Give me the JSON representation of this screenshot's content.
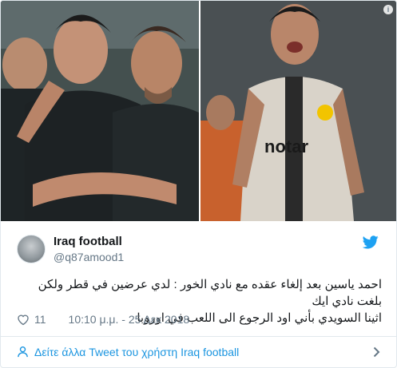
{
  "tweet": {
    "display_name": "Iraq football",
    "handle": "@q87amood1",
    "text_line1": "احمد ياسين بعد إلغاء عقده مع نادي الخور : لدي عرضين في قطر ولكن بلغت نادي ايك",
    "text_line2": "اثينا السويدي بأني اود الرجوع الى اللعب في اوروبا",
    "like_count": "11",
    "timestamp": "10:10 μ.μ. - 25 Δεκ 2018"
  },
  "footer": {
    "more_tweets_label": "Δείτε άλλα Tweet του χρήστη Iraq football"
  },
  "media": {
    "right_photo_shirt_text": "notar"
  },
  "colors": {
    "link": "#1b95e0",
    "twitter_blue": "#1da1f2",
    "secondary_text": "#657786",
    "border": "#e1e8ed"
  },
  "icons": {
    "logo": "twitter-bird-icon",
    "like": "heart-icon",
    "more": "user-icon",
    "chevron": "chevron-right-icon",
    "info": "info-icon"
  }
}
